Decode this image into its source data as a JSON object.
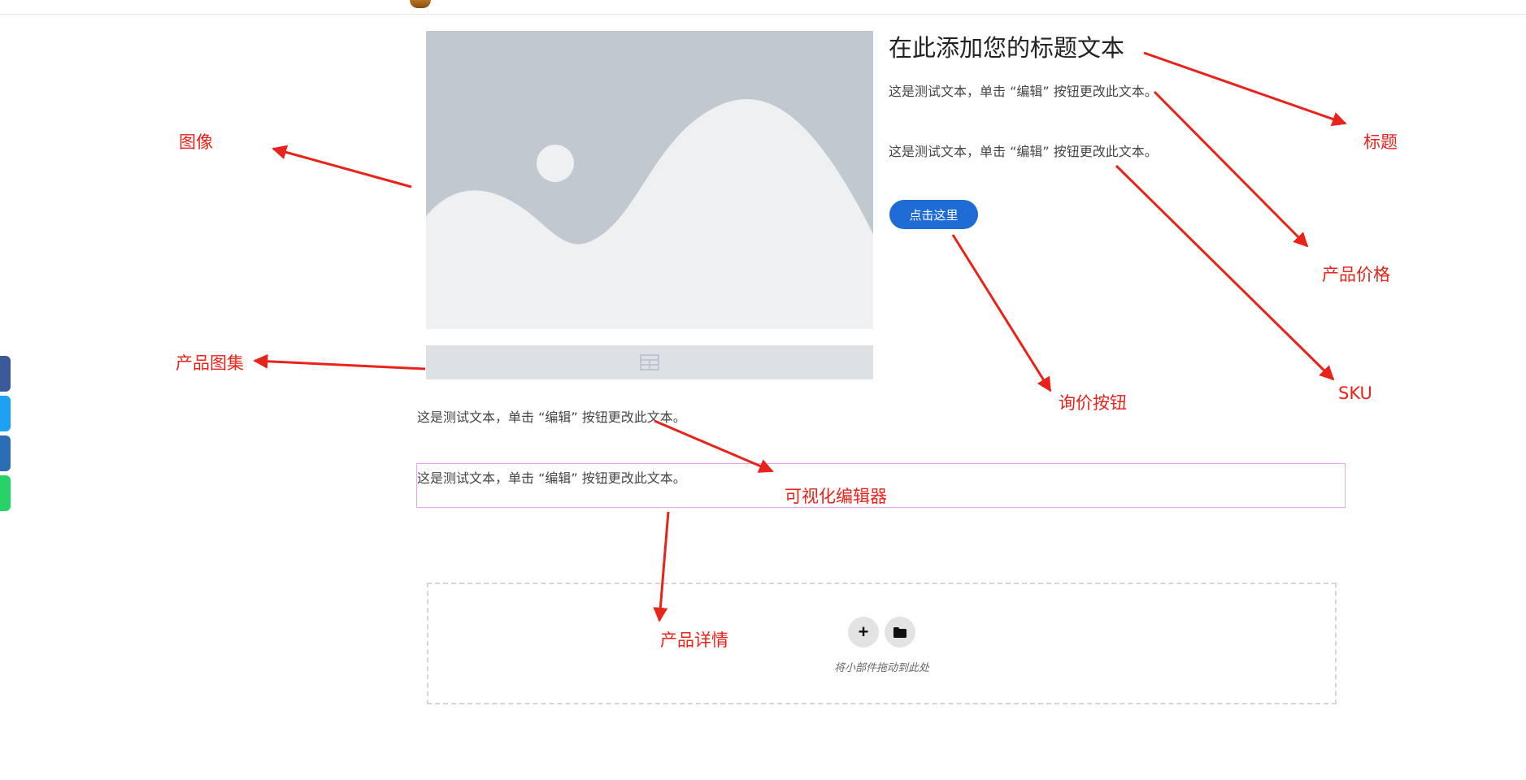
{
  "colors": {
    "accent_button": "#1f6bd6",
    "annotation_red": "#e8231a",
    "placeholder_bg": "#c0c9d0",
    "placeholder_fg": "#eef0f2",
    "editor_outline": "#e9a6f0",
    "social_facebook": "#3b5998",
    "social_twitter": "#1da1f2",
    "social_linkedin": "#2d6db5",
    "social_whatsapp": "#25d366"
  },
  "product": {
    "title": "在此添加您的标题文本",
    "price_text": "这是测试文本，单击 “编辑” 按钮更改此文本。",
    "sku_text": "这是测试文本，单击 “编辑” 按钮更改此文本。",
    "button_label": "点击这里"
  },
  "content": {
    "text_1": "这是测试文本，单击 “编辑” 按钮更改此文本。",
    "text_2": "这是测试文本，单击 “编辑” 按钮更改此文本。"
  },
  "drop_zone": {
    "add_icon": "plus-icon",
    "add_symbol": "+",
    "template_icon": "folder-icon",
    "hint": "将小部件拖动到此处"
  },
  "annotations": {
    "image": "图像",
    "gallery": "产品图集",
    "title": "标题",
    "price": "产品价格",
    "inquiry_button": "询价按钮",
    "sku": "SKU",
    "editor": "可视化编辑器",
    "details": "产品详情"
  },
  "social_icons": [
    "facebook-icon",
    "twitter-icon",
    "linkedin-icon",
    "whatsapp-icon"
  ]
}
